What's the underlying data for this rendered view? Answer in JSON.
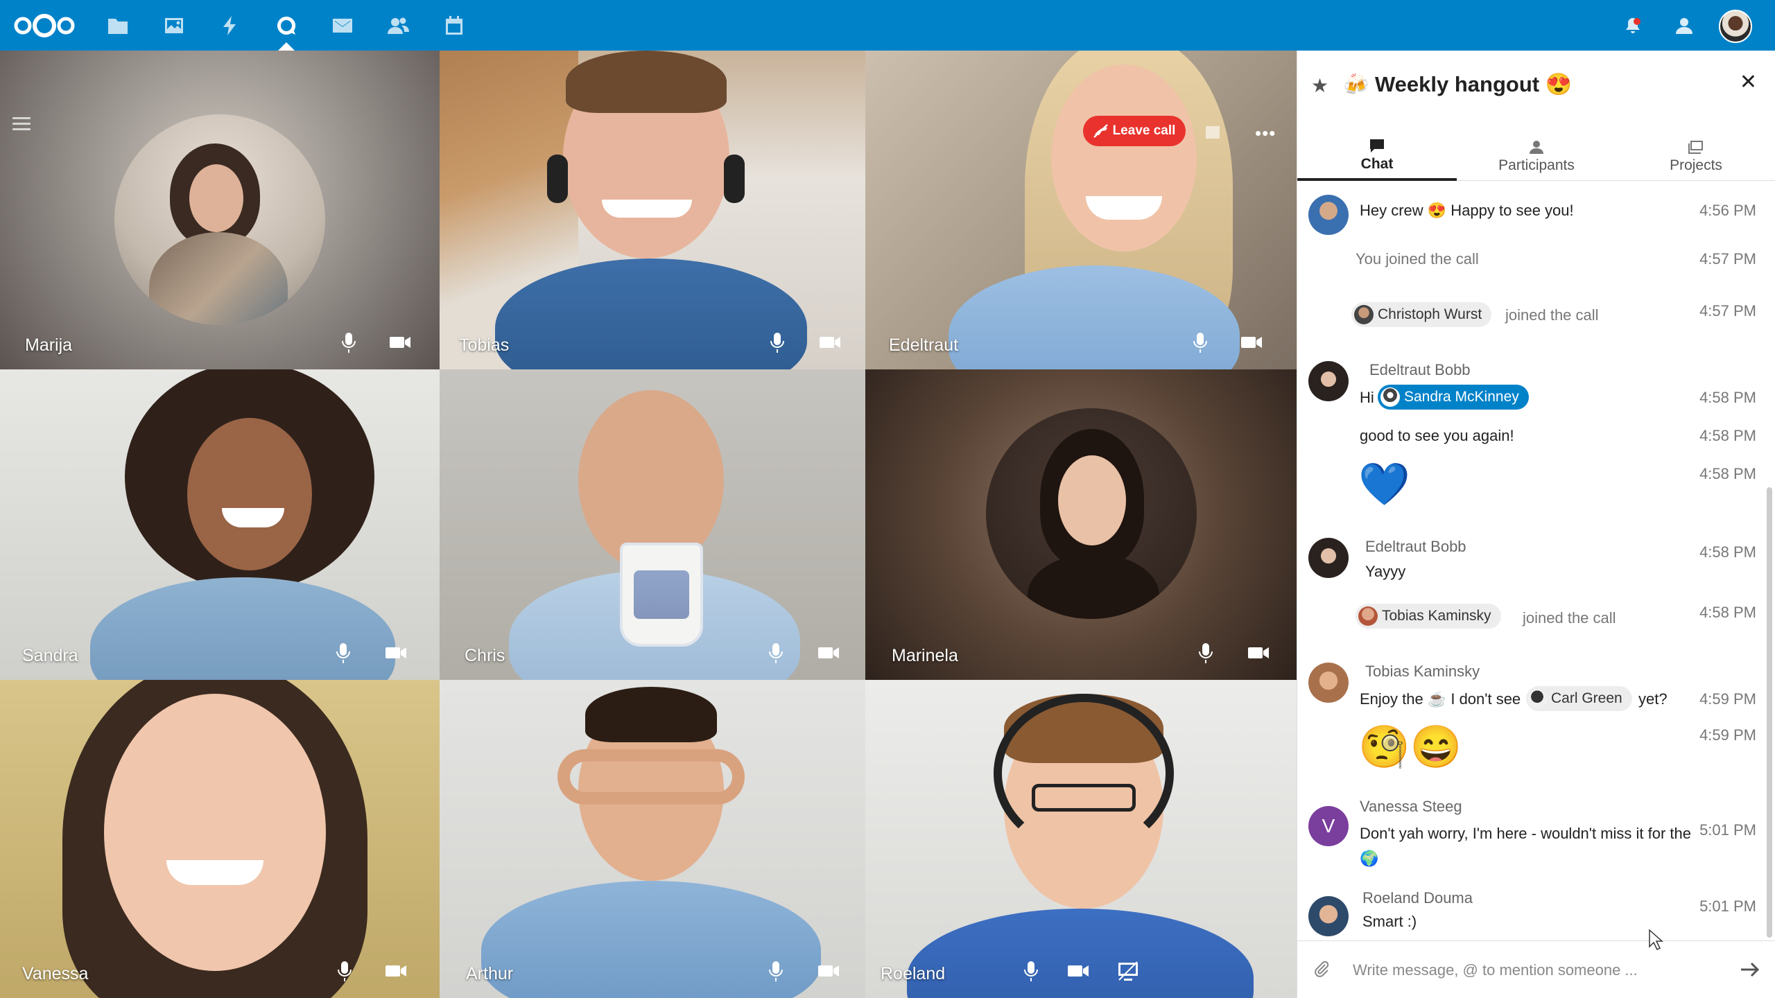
{
  "topbar": {
    "apps": [
      "files-icon",
      "photos-icon",
      "activity-icon",
      "talk-icon",
      "mail-icon",
      "contacts-icon",
      "calendar-icon"
    ],
    "active_app": "talk-icon",
    "right": [
      "notifications-icon",
      "contacts-menu-icon",
      "user-avatar"
    ]
  },
  "call": {
    "leave_label": "Leave call",
    "participants": [
      {
        "name": "Marija"
      },
      {
        "name": "Tobias"
      },
      {
        "name": "Edeltraut"
      },
      {
        "name": "Sandra"
      },
      {
        "name": "Chris"
      },
      {
        "name": "Marinela"
      },
      {
        "name": "Vanessa"
      },
      {
        "name": "Arthur"
      },
      {
        "name": "Roeland"
      }
    ]
  },
  "sidebar": {
    "title": "Weekly hangout",
    "tabs": [
      {
        "label": "Chat"
      },
      {
        "label": "Participants"
      },
      {
        "label": "Projects"
      }
    ],
    "messages": {
      "m1": {
        "text": "Hey crew 😍 Happy to see you!",
        "time": "4:56 PM"
      },
      "m2": {
        "text": "You joined the call",
        "time": "4:57 PM"
      },
      "m3": {
        "mention": "Christoph Wurst",
        "text": "joined the call",
        "time": "4:57 PM"
      },
      "m4": {
        "author": "Edeltraut Bobb",
        "prefix": "Hi",
        "mention": "Sandra McKinney",
        "time": "4:58 PM"
      },
      "m5": {
        "text": "good to see you again!",
        "time": "4:58 PM"
      },
      "m6": {
        "emoji": "💙",
        "time": "4:58 PM"
      },
      "m7": {
        "author": "Edeltraut Bobb",
        "text": "Yayyy",
        "time": "4:58 PM"
      },
      "m8": {
        "mention": "Tobias Kaminsky",
        "text": "joined the call",
        "time": "4:58 PM"
      },
      "m9": {
        "author": "Tobias Kaminsky",
        "text_a": "Enjoy the ☕ I don't see",
        "mention": "Carl Green",
        "text_b": "yet?",
        "time": "4:59 PM"
      },
      "m10": {
        "emoji": "🧐😄",
        "time": "4:59 PM"
      },
      "m11": {
        "author": "Vanessa Steeg",
        "avatar_letter": "V",
        "text": "Don't yah worry, I'm here - wouldn't miss it for the 🌍",
        "time": "5:01 PM"
      },
      "m12": {
        "author": "Roeland Douma",
        "text": "Smart :)",
        "time": "5:01 PM"
      }
    },
    "composer_placeholder": "Write message, @ to mention someone ..."
  },
  "colors": {
    "brand": "#0082c9",
    "leave": "#e9322d",
    "vanessa_avatar": "#7a3e9d"
  }
}
